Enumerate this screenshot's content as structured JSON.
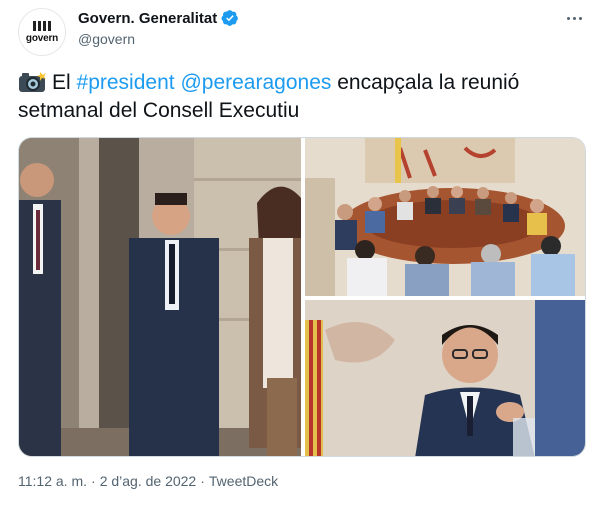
{
  "account": {
    "display_name": "Govern. Generalitat",
    "handle": "@govern",
    "avatar_text": "govern",
    "verified": true
  },
  "tweet": {
    "text_intro": "El",
    "hashtag": "#president",
    "mention": "@perearagones",
    "text_rest": "encapçala la reunió setmanal del Consell Executiu"
  },
  "footer": {
    "time": "11:12 a. m.",
    "date": "2 d’ag. de 2022",
    "separator": "·",
    "source": "TweetDeck"
  },
  "colors": {
    "link": "#1d9bf0",
    "verified": "#1d9bf0",
    "muted": "#536471"
  }
}
